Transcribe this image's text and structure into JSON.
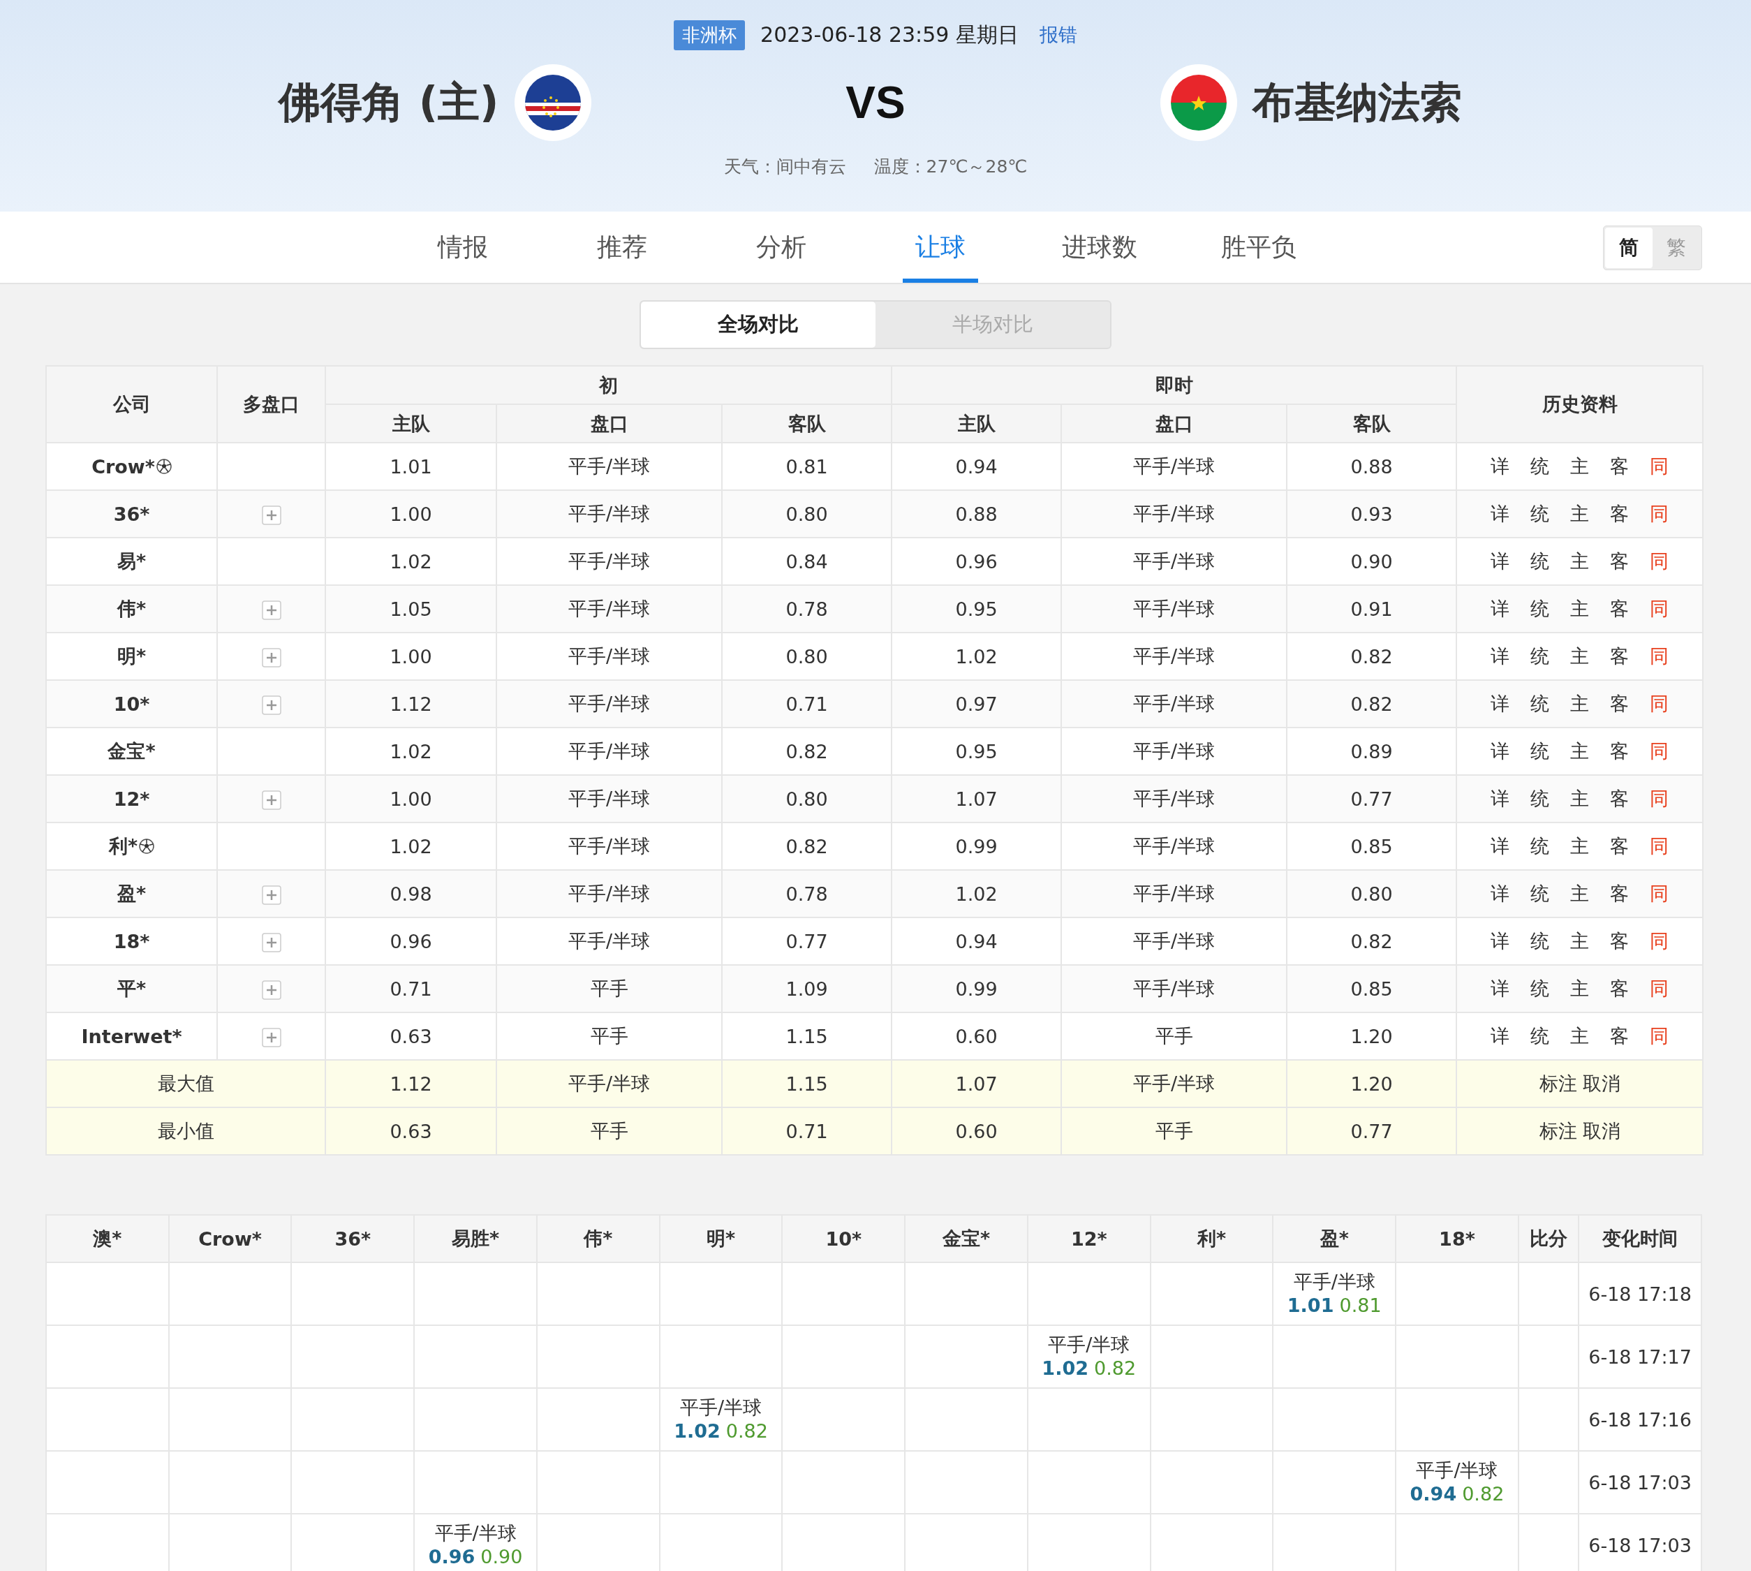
{
  "match": {
    "league": "非洲杯",
    "datetime": "2023-06-18 23:59 星期日",
    "report": "报错",
    "home": "佛得角 (主)",
    "vs": "VS",
    "away": "布基纳法索",
    "weather": "天气：间中有云",
    "temperature": "温度：27℃～28℃"
  },
  "tabs": [
    {
      "label": "情报",
      "selected": false
    },
    {
      "label": "推荐",
      "selected": false
    },
    {
      "label": "分析",
      "selected": false
    },
    {
      "label": "让球",
      "selected": true
    },
    {
      "label": "进球数",
      "selected": false
    },
    {
      "label": "胜平负",
      "selected": false
    }
  ],
  "language": [
    {
      "label": "简",
      "selected": true
    },
    {
      "label": "繁",
      "selected": false
    }
  ],
  "compare": [
    {
      "label": "全场对比",
      "selected": true
    },
    {
      "label": "半场对比",
      "selected": false
    }
  ],
  "odds_table": {
    "headers": {
      "company": "公司",
      "multi": "多盘口",
      "initial": {
        "label": "初",
        "columns": [
          "主队",
          "盘口",
          "客队"
        ]
      },
      "live": {
        "label": "即时",
        "columns": [
          "主队",
          "盘口",
          "客队"
        ]
      },
      "history": "历史资料"
    },
    "rows": [
      {
        "company": "Crow*",
        "ball": true,
        "multi": false,
        "initial": [
          "1.01",
          "平手/半球",
          "0.81"
        ],
        "live": [
          "0.94",
          "平手/半球",
          "0.88"
        ],
        "links": [
          "详",
          "统",
          "主",
          "客",
          "同"
        ]
      },
      {
        "company": "36*",
        "ball": false,
        "multi": true,
        "initial": [
          "1.00",
          "平手/半球",
          "0.80"
        ],
        "live": [
          "0.88",
          "平手/半球",
          "0.93"
        ],
        "links": [
          "详",
          "统",
          "主",
          "客",
          "同"
        ]
      },
      {
        "company": "易*",
        "ball": false,
        "multi": false,
        "initial": [
          "1.02",
          "平手/半球",
          "0.84"
        ],
        "live": [
          "0.96",
          "平手/半球",
          "0.90"
        ],
        "links": [
          "详",
          "统",
          "主",
          "客",
          "同"
        ]
      },
      {
        "company": "伟*",
        "ball": false,
        "multi": true,
        "initial": [
          "1.05",
          "平手/半球",
          "0.78"
        ],
        "live": [
          "0.95",
          "平手/半球",
          "0.91"
        ],
        "links": [
          "详",
          "统",
          "主",
          "客",
          "同"
        ]
      },
      {
        "company": "明*",
        "ball": false,
        "multi": true,
        "initial": [
          "1.00",
          "平手/半球",
          "0.80"
        ],
        "live": [
          "1.02",
          "平手/半球",
          "0.82"
        ],
        "links": [
          "详",
          "统",
          "主",
          "客",
          "同"
        ]
      },
      {
        "company": "10*",
        "ball": false,
        "multi": true,
        "initial": [
          "1.12",
          "平手/半球",
          "0.71"
        ],
        "live": [
          "0.97",
          "平手/半球",
          "0.82"
        ],
        "links": [
          "详",
          "统",
          "主",
          "客",
          "同"
        ]
      },
      {
        "company": "金宝*",
        "ball": false,
        "multi": false,
        "initial": [
          "1.02",
          "平手/半球",
          "0.82"
        ],
        "live": [
          "0.95",
          "平手/半球",
          "0.89"
        ],
        "links": [
          "详",
          "统",
          "主",
          "客",
          "同"
        ]
      },
      {
        "company": "12*",
        "ball": false,
        "multi": true,
        "initial": [
          "1.00",
          "平手/半球",
          "0.80"
        ],
        "live": [
          "1.07",
          "平手/半球",
          "0.77"
        ],
        "links": [
          "详",
          "统",
          "主",
          "客",
          "同"
        ]
      },
      {
        "company": "利*",
        "ball": true,
        "multi": false,
        "initial": [
          "1.02",
          "平手/半球",
          "0.82"
        ],
        "live": [
          "0.99",
          "平手/半球",
          "0.85"
        ],
        "links": [
          "详",
          "统",
          "主",
          "客",
          "同"
        ]
      },
      {
        "company": "盈*",
        "ball": false,
        "multi": true,
        "initial": [
          "0.98",
          "平手/半球",
          "0.78"
        ],
        "live": [
          "1.02",
          "平手/半球",
          "0.80"
        ],
        "links": [
          "详",
          "统",
          "主",
          "客",
          "同"
        ]
      },
      {
        "company": "18*",
        "ball": false,
        "multi": true,
        "initial": [
          "0.96",
          "平手/半球",
          "0.77"
        ],
        "live": [
          "0.94",
          "平手/半球",
          "0.82"
        ],
        "links": [
          "详",
          "统",
          "主",
          "客",
          "同"
        ]
      },
      {
        "company": "平*",
        "ball": false,
        "multi": true,
        "initial": [
          "0.71",
          "平手",
          "1.09"
        ],
        "live": [
          "0.99",
          "平手/半球",
          "0.85"
        ],
        "links": [
          "详",
          "统",
          "主",
          "客",
          "同"
        ]
      },
      {
        "company": "Interwet*",
        "ball": false,
        "multi": true,
        "initial": [
          "0.63",
          "平手",
          "1.15"
        ],
        "live": [
          "0.60",
          "平手",
          "1.20"
        ],
        "links": [
          "详",
          "统",
          "主",
          "客",
          "同"
        ]
      }
    ],
    "summary": [
      {
        "label": "最大值",
        "initial": [
          "1.12",
          "平手/半球",
          "1.15"
        ],
        "live": [
          "1.07",
          "平手/半球",
          "1.20"
        ],
        "actions": [
          "标注",
          "取消"
        ]
      },
      {
        "label": "最小值",
        "initial": [
          "0.63",
          "平手",
          "0.71"
        ],
        "live": [
          "0.60",
          "平手",
          "0.77"
        ],
        "actions": [
          "标注",
          "取消"
        ]
      }
    ]
  },
  "change_table": {
    "columns": [
      "澳*",
      "Crow*",
      "36*",
      "易胜*",
      "伟*",
      "明*",
      "10*",
      "金宝*",
      "12*",
      "利*",
      "盈*",
      "18*",
      "比分",
      "变化时间"
    ],
    "rows": [
      {
        "cells": [
          {},
          {},
          {},
          {},
          {},
          {},
          {},
          {},
          {},
          {},
          {
            "line": "平手/半球",
            "home": "1.01",
            "away": "0.81"
          },
          {},
          {}
        ],
        "time": "6-18 17:18"
      },
      {
        "cells": [
          {},
          {},
          {},
          {},
          {},
          {},
          {},
          {},
          {
            "line": "平手/半球",
            "home": "1.02",
            "away": "0.82"
          },
          {},
          {},
          {},
          {}
        ],
        "time": "6-18 17:17"
      },
      {
        "cells": [
          {},
          {},
          {},
          {},
          {},
          {
            "line": "平手/半球",
            "home": "1.02",
            "away": "0.82"
          },
          {},
          {},
          {},
          {},
          {},
          {},
          {}
        ],
        "time": "6-18 17:16"
      },
      {
        "cells": [
          {},
          {},
          {},
          {},
          {},
          {},
          {},
          {},
          {},
          {},
          {},
          {
            "line": "平手/半球",
            "home": "0.94",
            "away": "0.82"
          },
          {}
        ],
        "time": "6-18 17:03"
      },
      {
        "cells": [
          {},
          {},
          {},
          {
            "line": "平手/半球",
            "home": "0.96",
            "away": "0.90"
          },
          {},
          {},
          {},
          {},
          {},
          {},
          {},
          {},
          {}
        ],
        "time": "6-18 17:03"
      }
    ]
  }
}
